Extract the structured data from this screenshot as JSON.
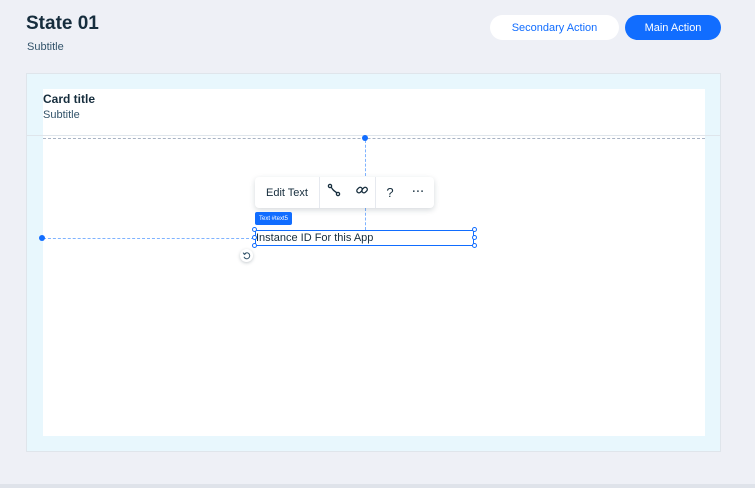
{
  "header": {
    "title": "State 01",
    "subtitle": "Subtitle",
    "secondary_action_label": "Secondary Action",
    "main_action_label": "Main Action"
  },
  "card": {
    "title": "Card title",
    "subtitle": "Subtitle"
  },
  "toolbar": {
    "edit_text_label": "Edit Text",
    "icons": [
      "connect-data-icon",
      "link-icon",
      "help-icon",
      "more-icon"
    ],
    "help_glyph": "?",
    "more_glyph": "···"
  },
  "element": {
    "tag_label": "Text #text5",
    "text": "Instance ID For this App"
  },
  "colors": {
    "accent": "#116dff",
    "page_bg": "#eef0f6",
    "canvas_bg": "#e8f7fd",
    "text": "#162d3d"
  }
}
